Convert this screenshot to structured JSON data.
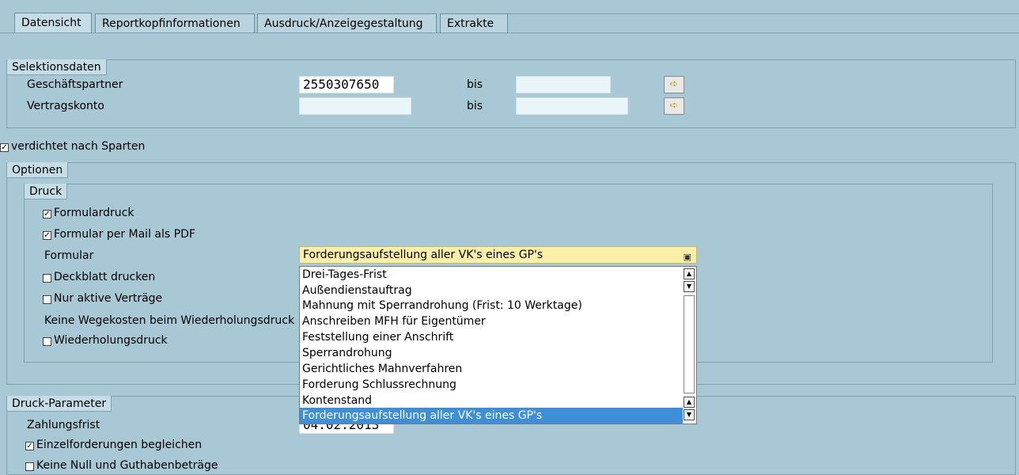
{
  "tabs": [
    "Datensicht",
    "Reportkopfinformationen",
    "Ausdruck/Anzeigegestaltung",
    "Extrakte"
  ],
  "selektionsdaten": {
    "title": "Selektionsdaten",
    "geschaeftspartner_label": "Geschäftspartner",
    "geschaeftspartner_value": "2550307650",
    "vertragskonto_label": "Vertragskonto",
    "vertragskonto_value": "",
    "bis_label": "bis"
  },
  "verdichtet": {
    "label": "verdichtet nach Sparten",
    "checked": true
  },
  "optionen": {
    "title": "Optionen",
    "druck": {
      "title": "Druck",
      "formulardruck": "Formulardruck",
      "formular_mail": "Formular per Mail als PDF",
      "formular_label": "Formular",
      "formular_selected": "Forderungsaufstellung aller VK's eines GP's",
      "deckblatt": "Deckblatt drucken",
      "nur_aktive": "Nur aktive Verträge",
      "keine_wegekosten": "Keine Wegekosten beim Wiederholungsdruck",
      "wiederholungsdruck": "Wiederholungsdruck"
    }
  },
  "dropdown_options": [
    "Drei-Tages-Frist",
    "Außendienstauftrag",
    "Mahnung mit Sperrandrohung (Frist: 10 Werktage)",
    "Anschreiben MFH für Eigentümer",
    "Feststellung einer Anschrift",
    "Sperrandrohung",
    "Gerichtliches Mahnverfahren",
    "Forderung Schlussrechnung",
    "Kontenstand",
    "Forderungsaufstellung aller VK's eines GP's"
  ],
  "druck_parameter": {
    "title": "Druck-Parameter",
    "zahlungsfrist_label": "Zahlungsfrist",
    "zahlungsfrist_value": "04.02.2013",
    "einzelforderungen": "Einzelforderungen begleichen",
    "keine_null": "Keine Null und Guthabenbeträge"
  },
  "colors": {
    "background": "#a9c8d6",
    "dropdown_bg": "#fbeea6",
    "selection": "#3d8fd9"
  },
  "icons": [
    "arrow-right-icon",
    "checkbox-icon",
    "dropdown-list-icon",
    "scroll-up-icon",
    "scroll-down-icon"
  ]
}
